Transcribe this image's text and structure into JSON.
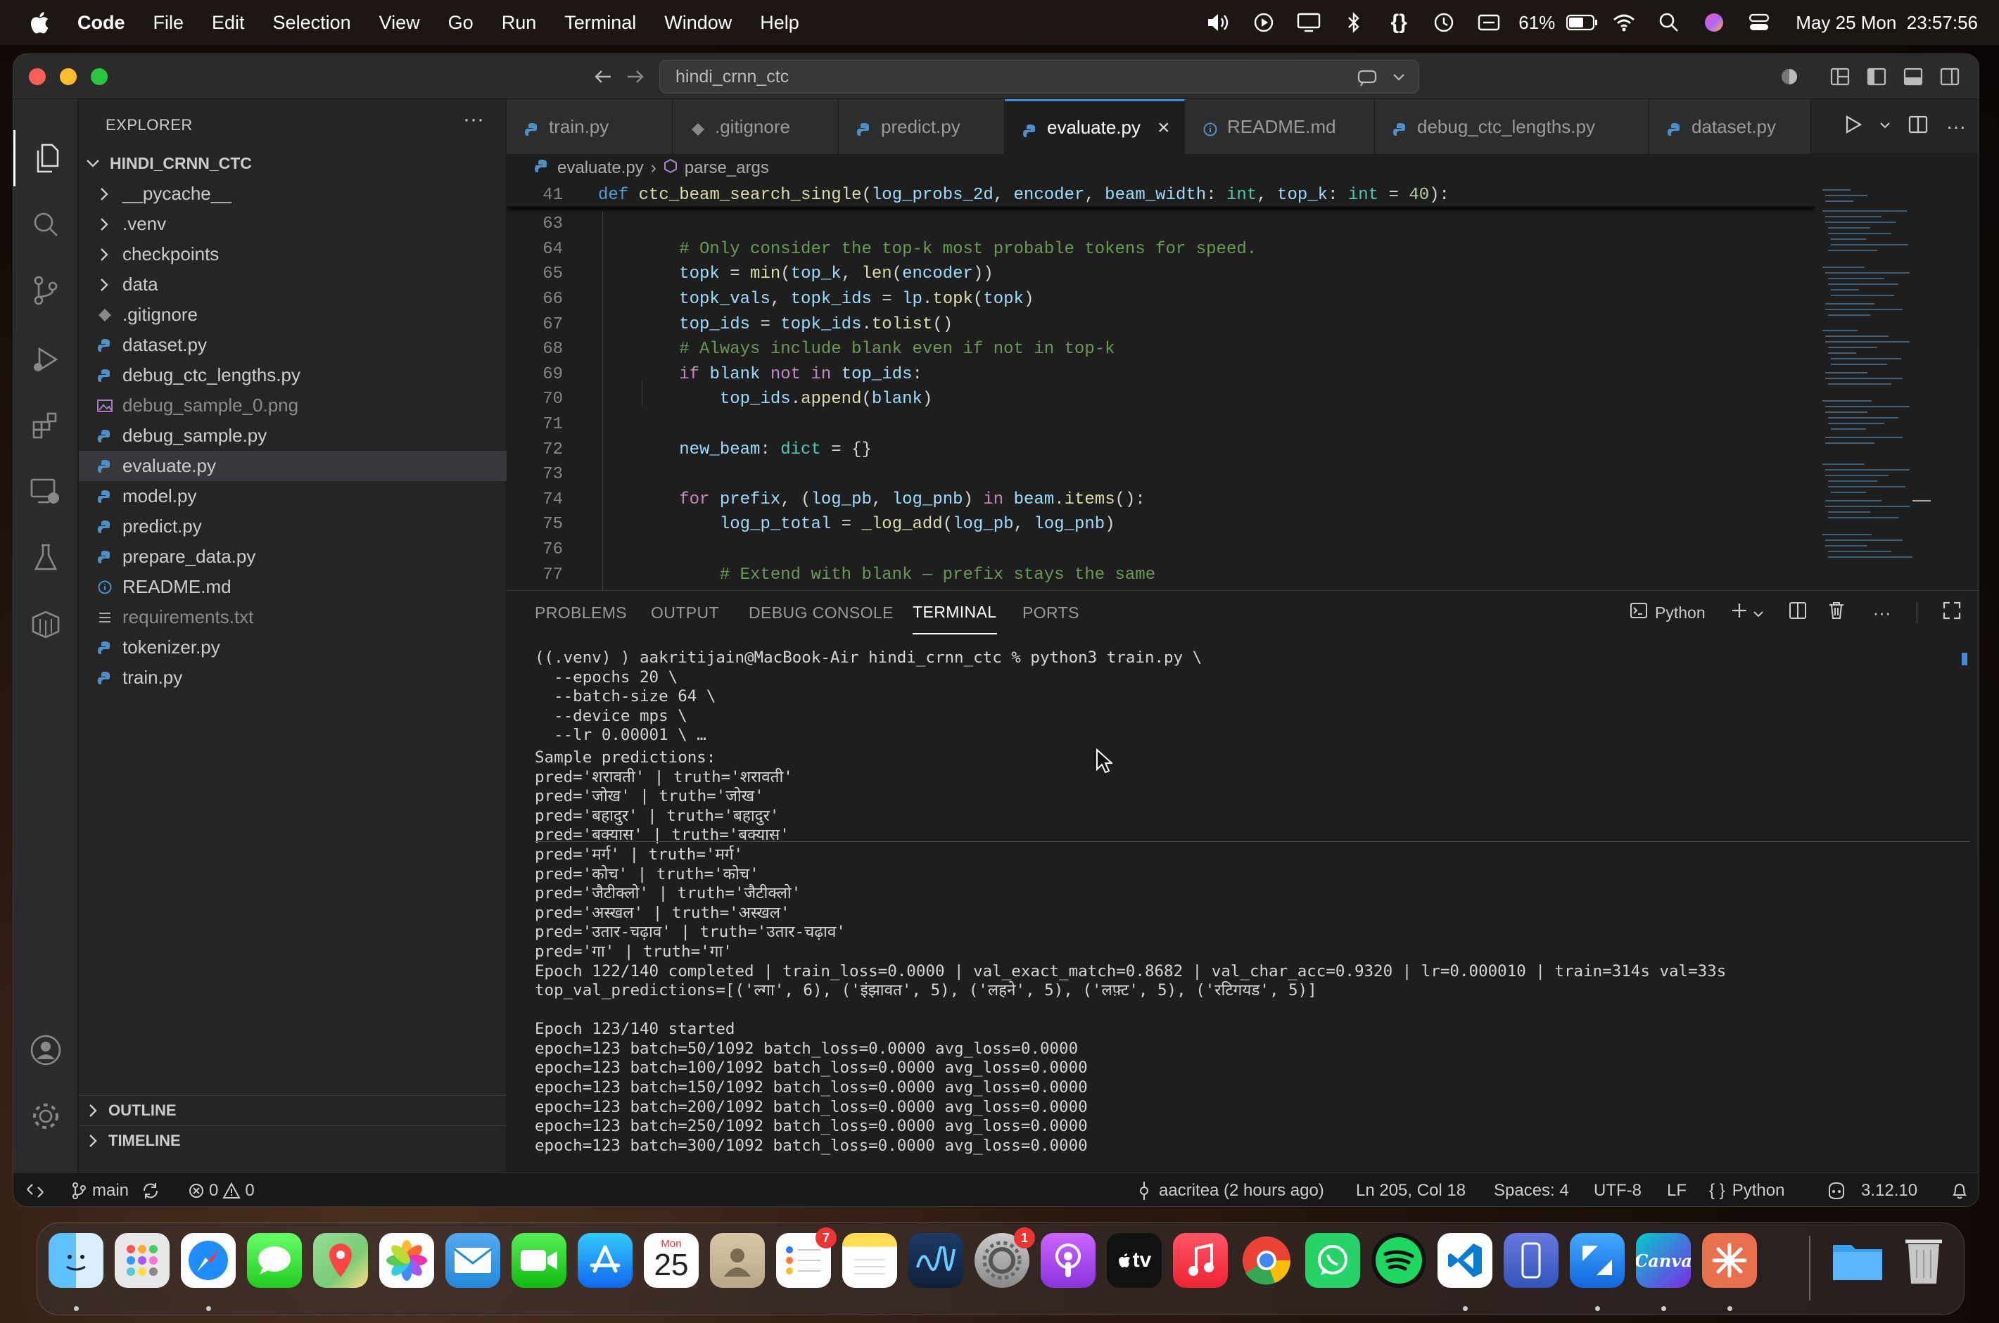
{
  "menubar": {
    "app": "Code",
    "items": [
      "File",
      "Edit",
      "Selection",
      "View",
      "Go",
      "Run",
      "Terminal",
      "Window",
      "Help"
    ],
    "battery": "61%",
    "datetime": "May 25 Mon  23:57:56"
  },
  "window": {
    "command_center": "hindi_crnn_ctc"
  },
  "explorer": {
    "title": "EXPLORER",
    "root": "HINDI_CRNN_CTC",
    "items": [
      {
        "label": "__pycache__",
        "kind": "folder"
      },
      {
        "label": ".venv",
        "kind": "folder"
      },
      {
        "label": "checkpoints",
        "kind": "folder"
      },
      {
        "label": "data",
        "kind": "folder"
      },
      {
        "label": ".gitignore",
        "kind": "git"
      },
      {
        "label": "dataset.py",
        "kind": "py"
      },
      {
        "label": "debug_ctc_lengths.py",
        "kind": "py"
      },
      {
        "label": "debug_sample_0.png",
        "kind": "png"
      },
      {
        "label": "debug_sample.py",
        "kind": "py"
      },
      {
        "label": "evaluate.py",
        "kind": "py"
      },
      {
        "label": "model.py",
        "kind": "py"
      },
      {
        "label": "predict.py",
        "kind": "py"
      },
      {
        "label": "prepare_data.py",
        "kind": "py"
      },
      {
        "label": "README.md",
        "kind": "info"
      },
      {
        "label": "requirements.txt",
        "kind": "txt"
      },
      {
        "label": "tokenizer.py",
        "kind": "py"
      },
      {
        "label": "train.py",
        "kind": "py"
      }
    ],
    "outline": "OUTLINE",
    "timeline": "TIMELINE"
  },
  "tabs": [
    "train.py",
    ".gitignore",
    "predict.py",
    "evaluate.py",
    "README.md",
    "debug_ctc_lengths.py",
    "dataset.py"
  ],
  "breadcrumb": {
    "file": "evaluate.py",
    "symbol": "parse_args"
  },
  "code": [
    {
      "n": "41",
      "t": "def ctc_beam_search_single(log_probs_2d, encoder, beam_width: int, top_k: int = 40):"
    },
    {
      "n": "63",
      "t": ""
    },
    {
      "n": "64",
      "t": "        # Only consider the top-k most probable tokens for speed."
    },
    {
      "n": "65",
      "t": "        topk = min(top_k, len(encoder))"
    },
    {
      "n": "66",
      "t": "        topk_vals, topk_ids = lp.topk(topk)"
    },
    {
      "n": "67",
      "t": "        top_ids = topk_ids.tolist()"
    },
    {
      "n": "68",
      "t": "        # Always include blank even if not in top-k"
    },
    {
      "n": "69",
      "t": "        if blank not in top_ids:"
    },
    {
      "n": "70",
      "t": "            top_ids.append(blank)"
    },
    {
      "n": "71",
      "t": ""
    },
    {
      "n": "72",
      "t": "        new_beam: dict = {}"
    },
    {
      "n": "73",
      "t": ""
    },
    {
      "n": "74",
      "t": "        for prefix, (log_pb, log_pnb) in beam.items():"
    },
    {
      "n": "75",
      "t": "            log_p_total = _log_add(log_pb, log_pnb)"
    },
    {
      "n": "76",
      "t": ""
    },
    {
      "n": "77",
      "t": "            # Extend with blank — prefix stays the same"
    }
  ],
  "panel": {
    "tabs": [
      "PROBLEMS",
      "OUTPUT",
      "DEBUG CONSOLE",
      "TERMINAL",
      "PORTS"
    ],
    "shell": "Python"
  },
  "terminal_cmd": [
    "((.venv) ) aakritijain@MacBook-Air hindi_crnn_ctc % python3 train.py \\",
    "  --epochs 20 \\",
    "  --batch-size 64 \\",
    "  --device mps \\",
    "  --lr 0.00001 \\ …"
  ],
  "terminal": [
    "Sample predictions:",
    "pred='शरावती' | truth='शरावती'",
    "pred='जोख' | truth='जोख'",
    "pred='बहादुर' | truth='बहादुर'",
    "pred='बक्यास' | truth='बक्यास'",
    "pred='मर्ग' | truth='मर्ग'",
    "pred='कोच' | truth='कोच'",
    "pred='जैटीक्लो' | truth='जैटीक्लो'",
    "pred='अस्खल' | truth='अस्खल'",
    "pred='उतार-चढ़ाव' | truth='उतार-चढ़ाव'",
    "pred='गा' | truth='गा'",
    "Epoch 122/140 completed | train_loss=0.0000 | val_exact_match=0.8682 | val_char_acc=0.9320 | lr=0.000010 | train=314s val=33s",
    "top_val_predictions=[('ल्गा', 6), ('इंझावत', 5), ('लहने', 5), ('लफ़्ट', 5), ('रटिगयड', 5)]",
    "",
    "Epoch 123/140 started",
    "epoch=123 batch=50/1092 batch_loss=0.0000 avg_loss=0.0000",
    "epoch=123 batch=100/1092 batch_loss=0.0000 avg_loss=0.0000",
    "epoch=123 batch=150/1092 batch_loss=0.0000 avg_loss=0.0000",
    "epoch=123 batch=200/1092 batch_loss=0.0000 avg_loss=0.0000",
    "epoch=123 batch=250/1092 batch_loss=0.0000 avg_loss=0.0000",
    "epoch=123 batch=300/1092 batch_loss=0.0000 avg_loss=0.0000"
  ],
  "status": {
    "branch": "main",
    "errors": "0",
    "warnings": "0",
    "blame": "aacritea (2 hours ago)",
    "position": "Ln 205, Col 18",
    "spaces": "Spaces: 4",
    "encoding": "UTF-8",
    "eol": "LF",
    "language": "Python",
    "python_version": "3.12.10"
  },
  "dock": {
    "calendar_month": "Mon",
    "calendar_day": "25",
    "reminders_badge": "7",
    "settings_badge": "1",
    "tv_label": "tv",
    "canva_label": "Canva"
  }
}
